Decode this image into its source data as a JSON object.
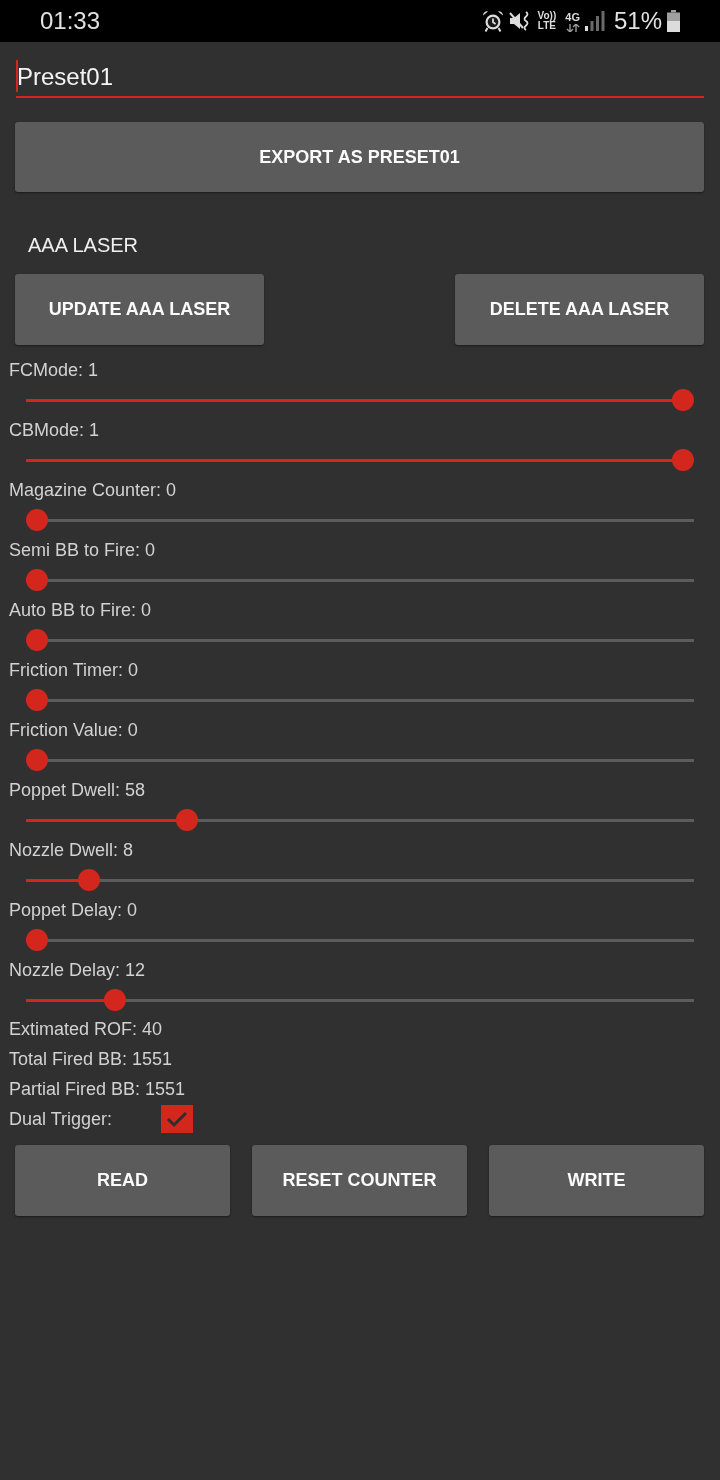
{
  "status_bar": {
    "time": "01:33",
    "volte": [
      "Vo))",
      "LTE"
    ],
    "network": "4G",
    "battery": "51%"
  },
  "preset_field": {
    "value": "Preset01"
  },
  "export_button": {
    "label": "EXPORT AS PRESET01"
  },
  "preset": {
    "name": "AAA LASER",
    "buttons": [
      "UPDATE AAA LASER",
      "DELETE AAA LASER"
    ]
  },
  "sliders": [
    {
      "label": "FCMode: 1",
      "level": 1
    },
    {
      "label": "CBMode: 1",
      "level": 1
    },
    {
      "label": "Magazine Counter: 0",
      "level": 0
    },
    {
      "label": "Semi BB to Fire: 0",
      "level": 0
    },
    {
      "label": "Auto BB to Fire: 0",
      "level": 0
    },
    {
      "label": "Friction Timer: 0",
      "level": 0
    },
    {
      "label": "Friction Value: 0",
      "level": 0
    },
    {
      "label": "Poppet Dwell: 58",
      "level": 0.232
    },
    {
      "label": "Nozzle Dwell: 8",
      "level": 0.08
    },
    {
      "label": "Poppet Delay: 0",
      "level": 0
    },
    {
      "label": "Nozzle Delay: 12",
      "level": 0.121
    }
  ],
  "readouts": [
    "Extimated ROF: 40",
    "Total Fired BB: 1551",
    "Partial Fired BB: 1551"
  ],
  "dual_trigger": {
    "label": "Dual Trigger:",
    "checked": true
  },
  "action_buttons": [
    "READ",
    "RESET COUNTER",
    "WRITE"
  ]
}
